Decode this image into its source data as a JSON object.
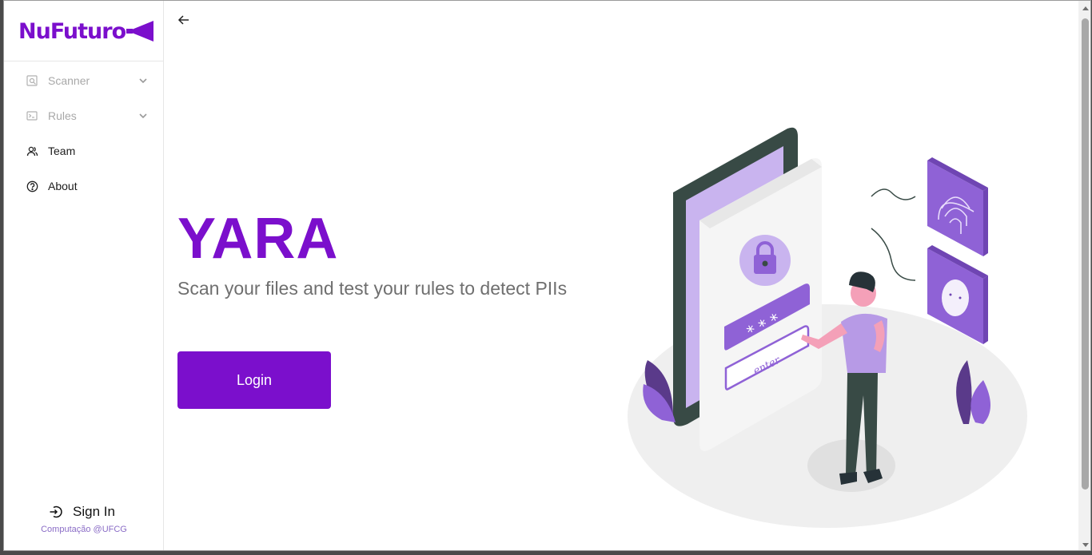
{
  "brand": {
    "name": "NuFuturo",
    "color": "#7b0fcc"
  },
  "sidebar": {
    "items": [
      {
        "label": "Scanner",
        "icon": "scan-document-icon",
        "disabled": true,
        "expandable": true
      },
      {
        "label": "Rules",
        "icon": "terminal-icon",
        "disabled": true,
        "expandable": true
      },
      {
        "label": "Team",
        "icon": "users-icon",
        "disabled": false,
        "expandable": false
      },
      {
        "label": "About",
        "icon": "help-circle-icon",
        "disabled": false,
        "expandable": false
      }
    ],
    "signin_label": "Sign In",
    "credit": "Computação @UFCG"
  },
  "main": {
    "title": "YARA",
    "subtitle": "Scan your files and test your rules to detect PIIs",
    "login_label": "Login",
    "illustration": {
      "field_text": "enter",
      "password_mask": "* * *"
    }
  },
  "colors": {
    "accent": "#7b0fcc",
    "illustration_purple": "#8f62d6",
    "illustration_light": "#c9b4ef"
  }
}
